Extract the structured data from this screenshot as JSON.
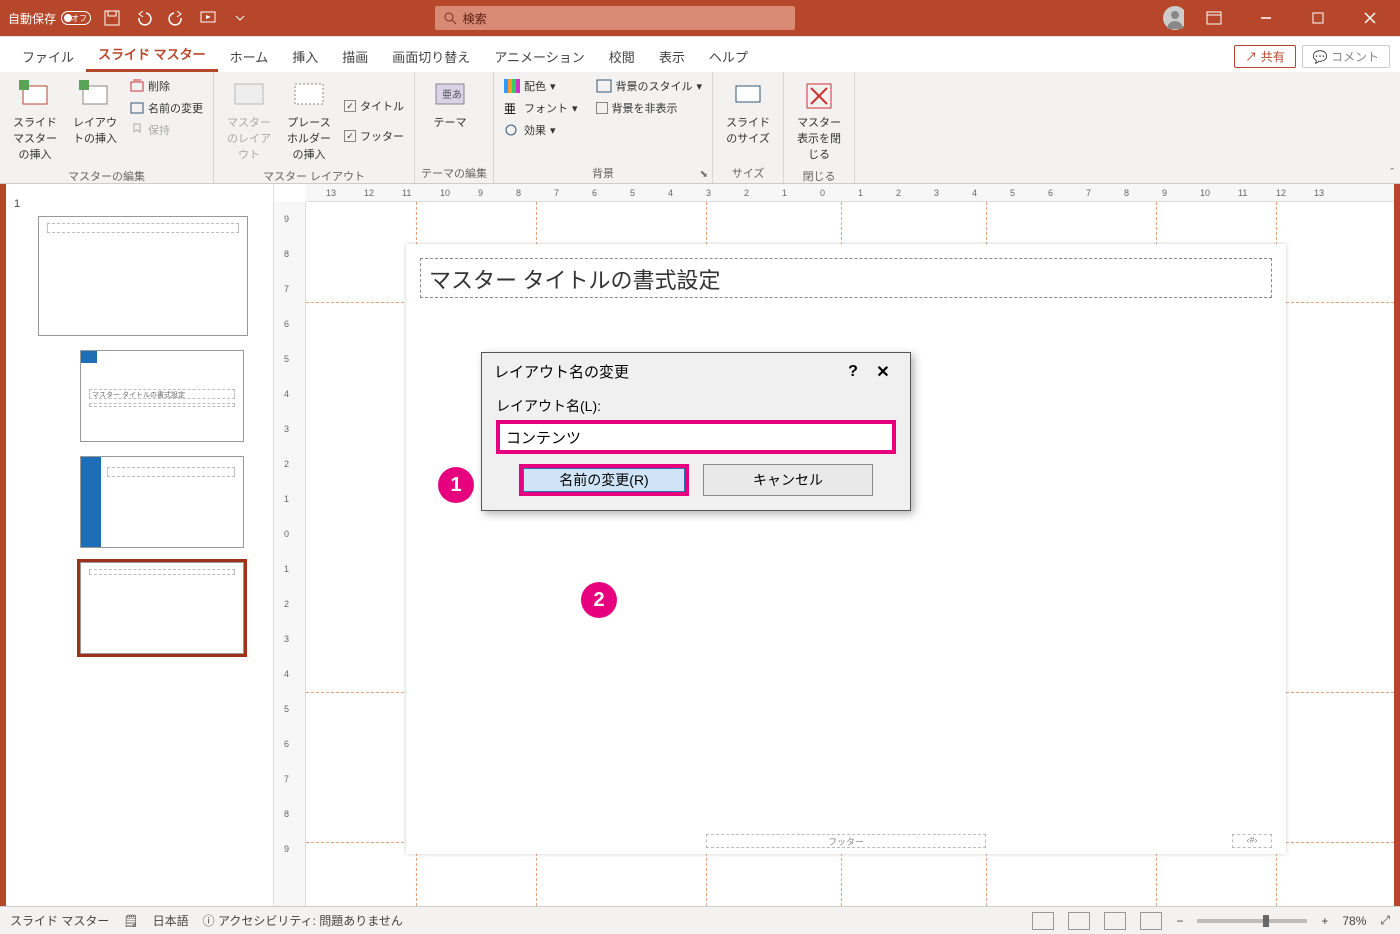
{
  "titlebar": {
    "autosave_label": "自動保存",
    "autosave_state": "オフ",
    "search_placeholder": "検索"
  },
  "tabs": {
    "file": "ファイル",
    "slide_master": "スライド マスター",
    "home": "ホーム",
    "insert": "挿入",
    "draw": "描画",
    "transitions": "画面切り替え",
    "animations": "アニメーション",
    "review": "校閲",
    "view": "表示",
    "help": "ヘルプ",
    "share": "共有",
    "comment": "コメント"
  },
  "ribbon": {
    "group1": {
      "insert_slide_master": "スライド マスターの挿入",
      "insert_layout": "レイアウトの挿入",
      "delete": "削除",
      "rename": "名前の変更",
      "preserve": "保持",
      "label": "マスターの編集"
    },
    "group2": {
      "master_layout": "マスターのレイアウト",
      "insert_placeholder": "プレースホルダーの挿入",
      "title_chk": "タイトル",
      "footer_chk": "フッター",
      "label": "マスター レイアウト"
    },
    "group3": {
      "themes": "テーマ",
      "label": "テーマの編集"
    },
    "group4": {
      "colors": "配色",
      "fonts": "フォント",
      "effects": "効果",
      "bg_styles": "背景のスタイル",
      "hide_bg": "背景を非表示",
      "label": "背景"
    },
    "group5": {
      "slide_size": "スライドのサイズ",
      "label": "サイズ"
    },
    "group6": {
      "close_master": "マスター表示を閉じる",
      "label": "閉じる"
    }
  },
  "ruler_h": [
    "13",
    "12",
    "11",
    "10",
    "9",
    "8",
    "7",
    "6",
    "5",
    "4",
    "3",
    "2",
    "1",
    "0",
    "1",
    "2",
    "3",
    "4",
    "5",
    "6",
    "7",
    "8",
    "9",
    "10",
    "11",
    "12",
    "13"
  ],
  "ruler_v": [
    "9",
    "8",
    "7",
    "6",
    "5",
    "4",
    "3",
    "2",
    "1",
    "0",
    "1",
    "2",
    "3",
    "4",
    "5",
    "6",
    "7",
    "8",
    "9"
  ],
  "slide": {
    "title_placeholder": "マスター タイトルの書式設定",
    "footer_placeholder": "フッター",
    "pagenum_placeholder": "‹#›"
  },
  "thumb_number": "1",
  "thumb_title_text": "マスター タイトルの書式設定",
  "dialog": {
    "title": "レイアウト名の変更",
    "field_label": "レイアウト名(L):",
    "field_value": "コンテンツ",
    "rename_btn": "名前の変更(R)",
    "cancel_btn": "キャンセル"
  },
  "callouts": {
    "one": "1",
    "two": "2"
  },
  "statusbar": {
    "mode": "スライド マスター",
    "language": "日本語",
    "accessibility": "アクセシビリティ: 問題ありません",
    "zoom": "78%"
  }
}
